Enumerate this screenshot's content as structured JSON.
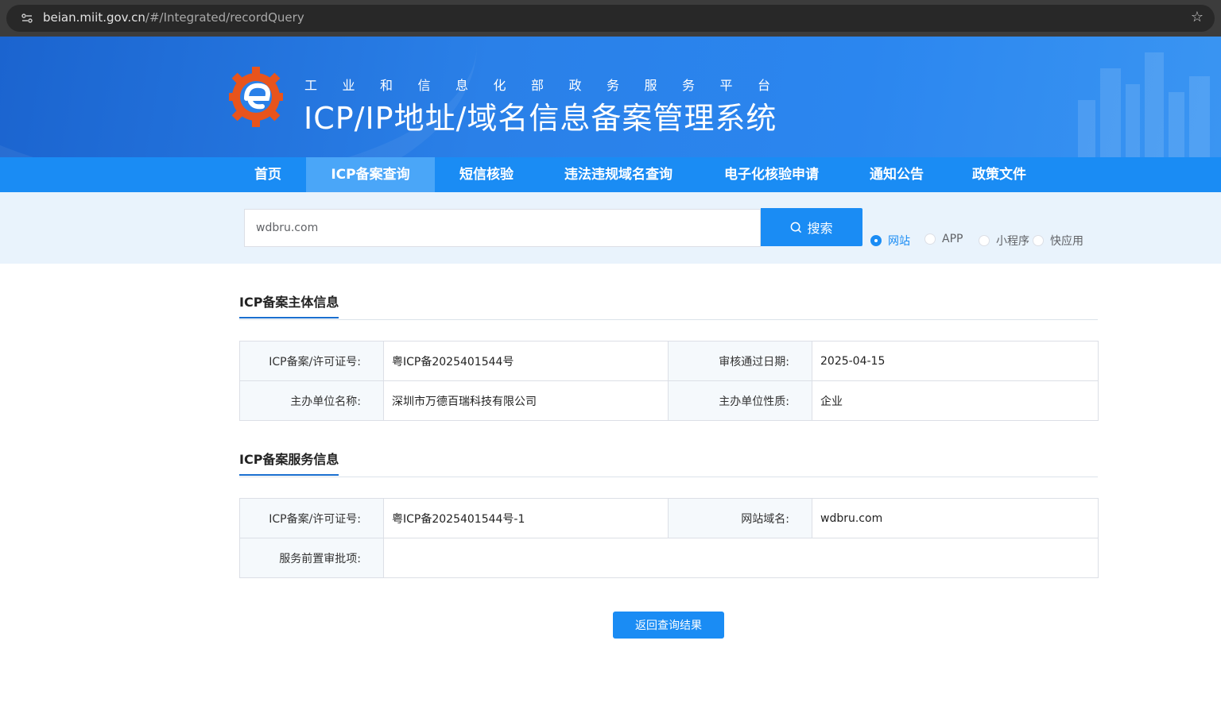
{
  "browser": {
    "url_host": "beian.miit.gov.cn",
    "url_path": "/#/Integrated/recordQuery"
  },
  "banner": {
    "subtitle": "工业和信息化部政务服务平台",
    "title": "ICP/IP地址/域名信息备案管理系统"
  },
  "nav": {
    "items": [
      "首页",
      "ICP备案查询",
      "短信核验",
      "违法违规域名查询",
      "电子化核验申请",
      "通知公告",
      "政策文件"
    ],
    "active_index": 1
  },
  "search": {
    "value": "wdbru.com",
    "button_label": "搜索",
    "options": [
      "网站",
      "APP",
      "小程序",
      "快应用"
    ],
    "selected_index": 0
  },
  "subject_info": {
    "title": "ICP备案主体信息",
    "rows": [
      {
        "label1": "ICP备案/许可证号:",
        "value1": "粤ICP备2025401544号",
        "label2": "审核通过日期:",
        "value2": "2025-04-15"
      },
      {
        "label1": "主办单位名称:",
        "value1": "深圳市万德百瑞科技有限公司",
        "label2": "主办单位性质:",
        "value2": "企业"
      }
    ]
  },
  "service_info": {
    "title": "ICP备案服务信息",
    "rows": [
      {
        "label1": "ICP备案/许可证号:",
        "value1": "粤ICP备2025401544号-1",
        "label2": "网站域名:",
        "value2": "wdbru.com"
      },
      {
        "label1": "服务前置审批项:",
        "value1": ""
      }
    ]
  },
  "back_button_label": "返回查询结果",
  "colors": {
    "primary": "#1a8cf4",
    "nav_active": "#4aa6f8",
    "search_bg": "#e9f3fc"
  }
}
